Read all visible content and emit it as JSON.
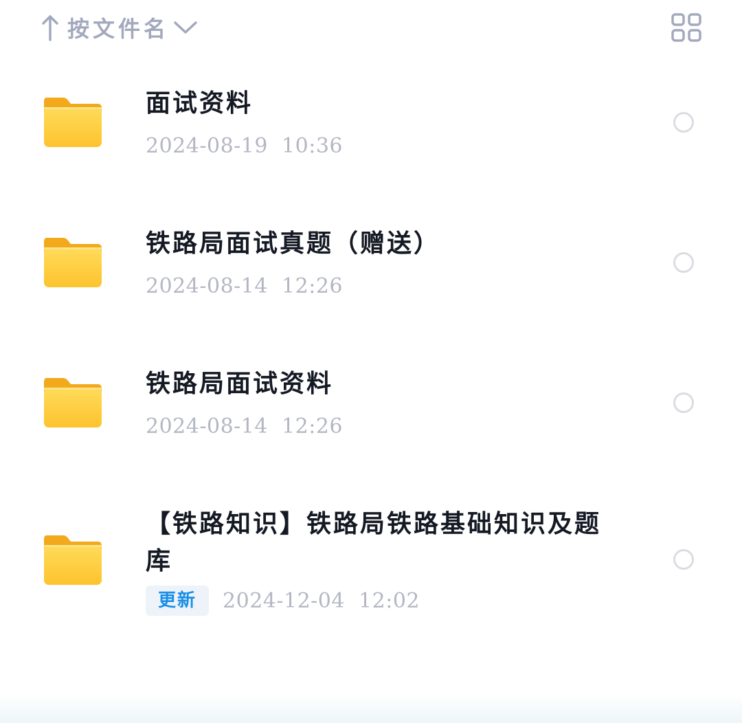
{
  "sort_bar": {
    "label": "按文件名",
    "arrow_icon": "arrow-up-icon",
    "dropdown_icon": "chevron-down-icon"
  },
  "view_toggle": {
    "icon": "grid-view-icon"
  },
  "colors": {
    "folder_yellow": "#FDC83B",
    "badge_blue": "#1A8FE6",
    "muted_text": "#A3A9BD"
  },
  "files": [
    {
      "name": "面试资料",
      "date": "2024-08-19  10:36",
      "icon": "folder-icon"
    },
    {
      "name": "铁路局面试真题（赠送）",
      "date": "2024-08-14  12:26",
      "icon": "folder-icon"
    },
    {
      "name": "铁路局面试资料",
      "date": "2024-08-14  12:26",
      "icon": "folder-icon"
    },
    {
      "name": "【铁路知识】铁路局铁路基础知识及题库",
      "date": "2024-12-04  12:02",
      "badge": "更新",
      "icon": "folder-icon"
    }
  ]
}
